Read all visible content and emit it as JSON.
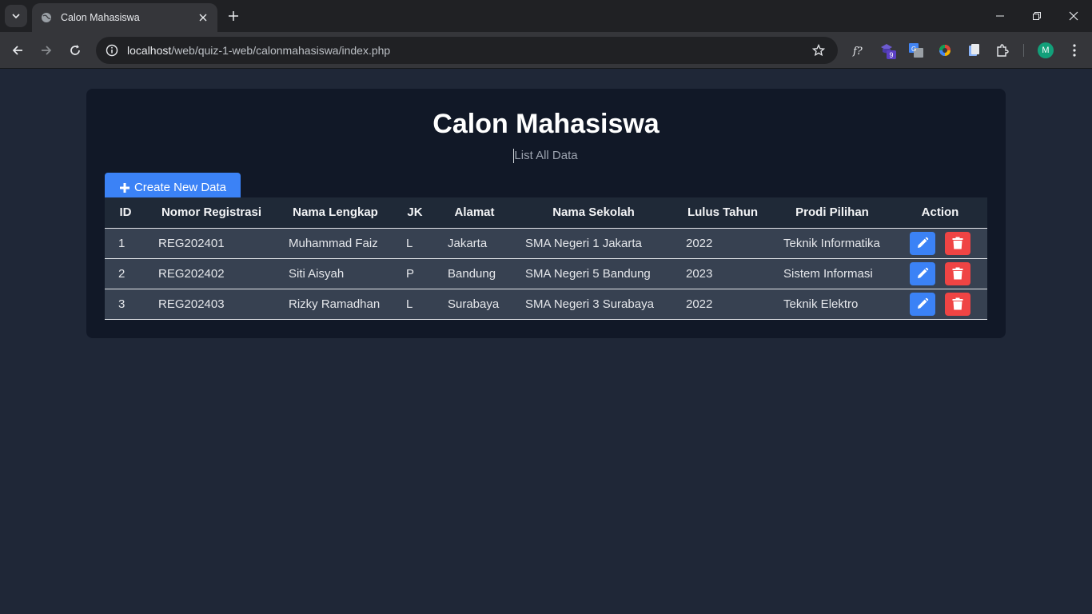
{
  "browser": {
    "tab_title": "Calon Mahasiswa",
    "url_host": "localhost",
    "url_path": "/web/quiz-1-web/calonmahasiswa/index.php",
    "extension_badge": "9",
    "profile_initial": "M"
  },
  "page": {
    "title": "Calon Mahasiswa",
    "subtitle": "List All Data",
    "create_label": "Create New Data"
  },
  "table": {
    "headers": [
      "ID",
      "Nomor Registrasi",
      "Nama Lengkap",
      "JK",
      "Alamat",
      "Nama Sekolah",
      "Lulus Tahun",
      "Prodi Pilihan",
      "Action"
    ],
    "rows": [
      {
        "id": "1",
        "reg": "REG202401",
        "nama": "Muhammad Faiz",
        "jk": "L",
        "alamat": "Jakarta",
        "sekolah": "SMA Negeri 1 Jakarta",
        "lulus": "2022",
        "prodi": "Teknik Informatika"
      },
      {
        "id": "2",
        "reg": "REG202402",
        "nama": "Siti Aisyah",
        "jk": "P",
        "alamat": "Bandung",
        "sekolah": "SMA Negeri 5 Bandung",
        "lulus": "2023",
        "prodi": "Sistem Informasi"
      },
      {
        "id": "3",
        "reg": "REG202403",
        "nama": "Rizky Ramadhan",
        "jk": "L",
        "alamat": "Surabaya",
        "sekolah": "SMA Negeri 3 Surabaya",
        "lulus": "2022",
        "prodi": "Teknik Elektro"
      }
    ]
  },
  "colors": {
    "primary": "#3b82f6",
    "danger": "#ef4444",
    "card": "#111827",
    "background": "#1f2737"
  }
}
